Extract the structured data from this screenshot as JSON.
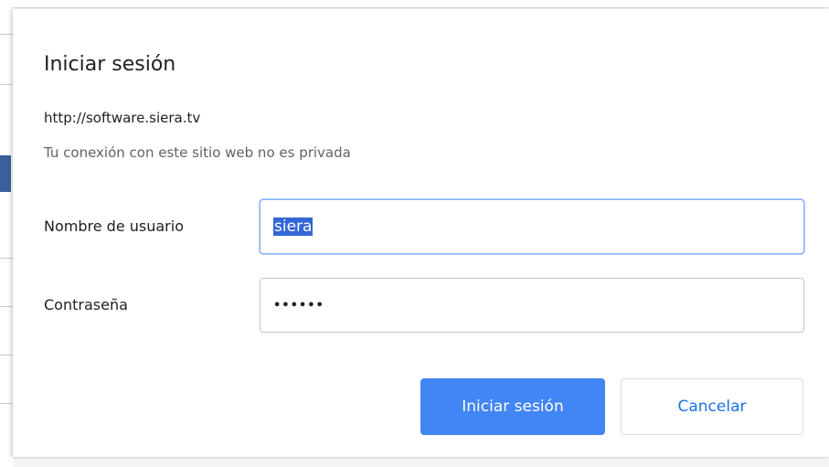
{
  "dialog": {
    "title": "Iniciar sesión",
    "url": "http://software.siera.tv",
    "privacy_note": "Tu conexión con este sitio web no es privada"
  },
  "form": {
    "username_label": "Nombre de usuario",
    "username_value": "siera",
    "password_label": "Contraseña",
    "password_value": "••••••"
  },
  "buttons": {
    "submit_label": "Iniciar sesión",
    "cancel_label": "Cancelar"
  },
  "colors": {
    "primary": "#4285f4",
    "link": "#1a73e8",
    "selection": "#3367d6"
  }
}
